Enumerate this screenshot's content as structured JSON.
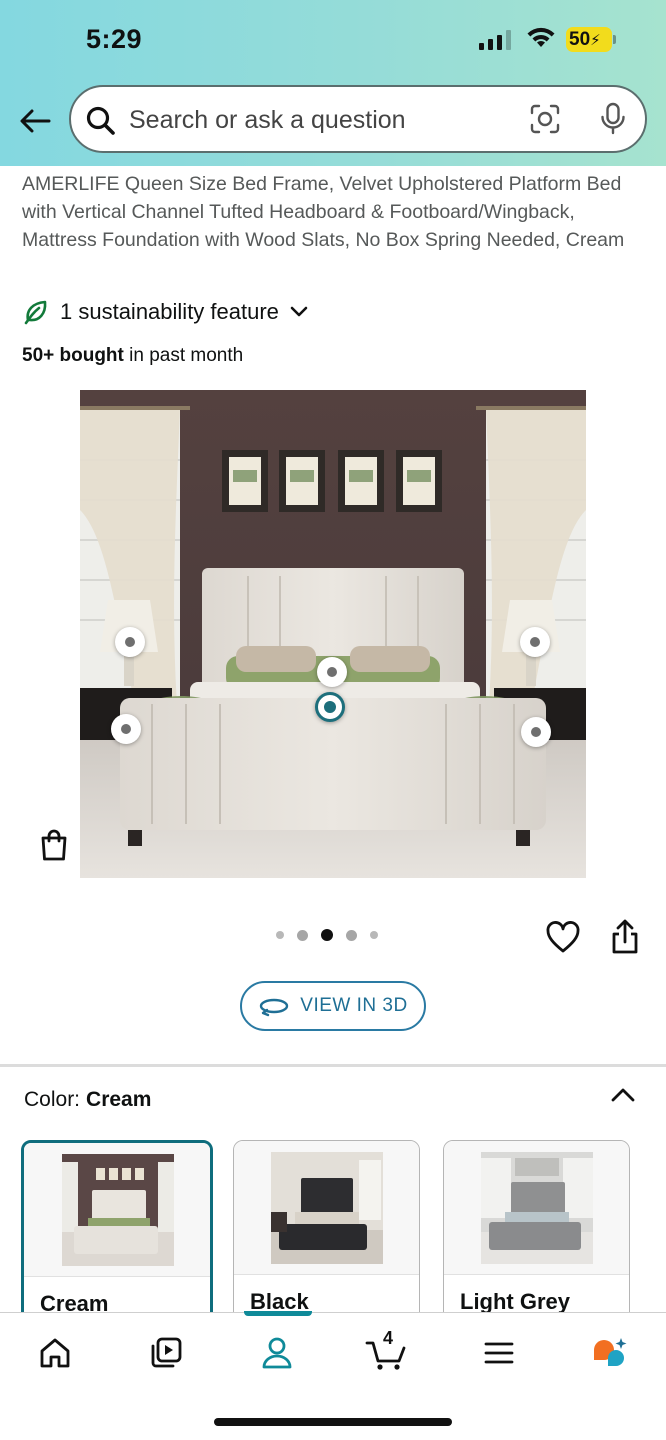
{
  "status_bar": {
    "time": "5:29",
    "battery": "50"
  },
  "search": {
    "placeholder": "Search or ask a question"
  },
  "product": {
    "title": "AMERLIFE Queen Size Bed Frame, Velvet Upholstered Platform Bed with Vertical Channel Tufted Headboard & Footboard/Wingback, Mattress Foundation with Wood Slats, No Box Spring Needed, Cream",
    "sustainability": "1 sustainability feature",
    "bought_bold": "50+ bought",
    "bought_rest": " in past month"
  },
  "carousel": {
    "total": 5,
    "active_index": 2
  },
  "view3d": {
    "label": "VIEW IN 3D"
  },
  "color": {
    "label": "Color:",
    "selected": "Cream",
    "options": [
      {
        "label": "Cream",
        "selected": true
      },
      {
        "label": "Black",
        "selected": false
      },
      {
        "label": "Light Grey",
        "selected": false
      }
    ]
  },
  "nav": {
    "cart_count": "4",
    "items": [
      "home-icon",
      "video-icon",
      "account-icon",
      "cart-icon",
      "menu-icon",
      "rufus-icon"
    ],
    "active": "account-icon"
  },
  "colors": {
    "header_gradient_start": "#84d8e0",
    "header_gradient_end": "#a6e3cf",
    "accent_teal": "#0f6d7d",
    "link_blue": "#1f6f95",
    "sustain_green": "#127a3a",
    "rufus_orange": "#f26f21"
  }
}
